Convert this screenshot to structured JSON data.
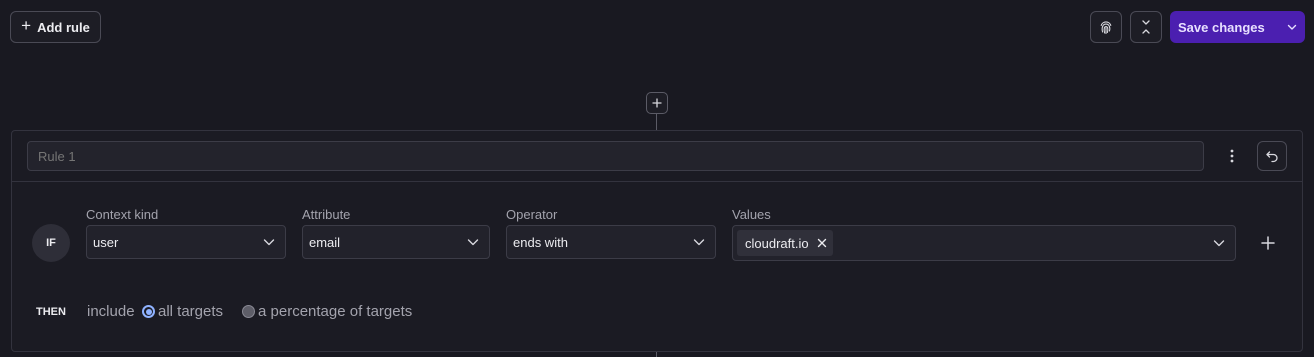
{
  "toolbar": {
    "add_rule_label": "Add rule",
    "save_label": "Save changes",
    "fingerprint_icon": "fingerprint-icon",
    "collapse_icon": "collapse-icon"
  },
  "rule": {
    "name_placeholder": "Rule 1",
    "name_value": "",
    "if_label": "IF",
    "then_label": "THEN",
    "clause": {
      "context_kind": {
        "label": "Context kind",
        "value": "user"
      },
      "attribute": {
        "label": "Attribute",
        "value": "email"
      },
      "operator": {
        "label": "Operator",
        "value": "ends with"
      },
      "values": {
        "label": "Values",
        "items": [
          "cloudraft.io"
        ]
      }
    },
    "rollout": {
      "include_label": "include",
      "options": [
        {
          "label": "all targets",
          "selected": true
        },
        {
          "label": "a percentage of targets",
          "selected": false
        }
      ]
    }
  },
  "colors": {
    "background": "#191921",
    "accent": "#4b1fb0",
    "radio_accent": "#8fb2ff"
  }
}
